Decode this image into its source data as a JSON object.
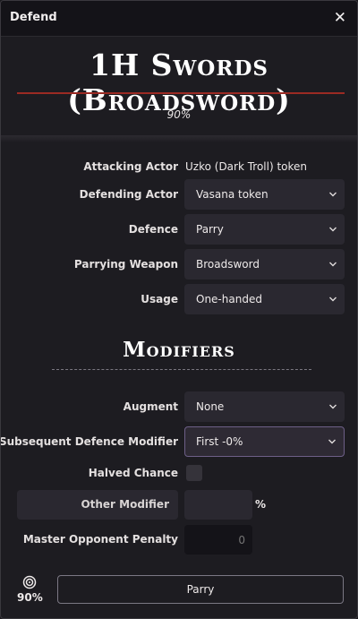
{
  "window": {
    "title": "Defend"
  },
  "header": {
    "title": "1H Swords (Broadsword)",
    "chance": "90%"
  },
  "form": {
    "attacking_actor": {
      "label": "Attacking Actor",
      "value": "Uzko (Dark Troll) token"
    },
    "defending_actor": {
      "label": "Defending Actor",
      "value": "Vasana token"
    },
    "defence": {
      "label": "Defence",
      "value": "Parry"
    },
    "parrying_weapon": {
      "label": "Parrying Weapon",
      "value": "Broadsword"
    },
    "usage": {
      "label": "Usage",
      "value": "One-handed"
    }
  },
  "modifiers": {
    "heading": "Modifiers",
    "augment": {
      "label": "Augment",
      "value": "None"
    },
    "subsequent_defence": {
      "label": "Subsequent Defence Modifier",
      "value": "First -0%"
    },
    "halved_chance": {
      "label": "Halved Chance",
      "checked": false
    },
    "other_modifier": {
      "label": "Other Modifier",
      "value": "",
      "unit": "%"
    },
    "master_opponent_penalty": {
      "label": "Master Opponent Penalty",
      "value": "0"
    }
  },
  "footer": {
    "chance": "90%",
    "button_label": "Parry"
  },
  "colors": {
    "accent_rule": "#9b2a23",
    "focus_border": "#6d5f87",
    "background": "#1d1c21"
  }
}
